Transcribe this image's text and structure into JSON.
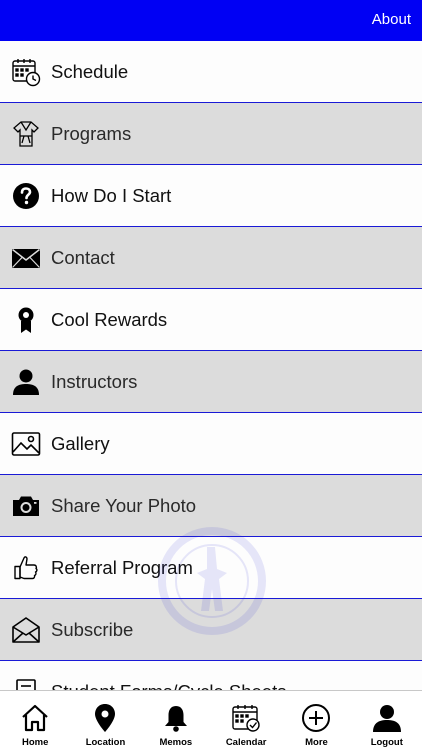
{
  "header": {
    "about_label": "About",
    "background_color": "#0000f4"
  },
  "menu": {
    "items": [
      {
        "label": "Schedule",
        "icon": "calendar-clock-icon"
      },
      {
        "label": "Programs",
        "icon": "martial-arts-uniform-icon"
      },
      {
        "label": "How Do I Start",
        "icon": "question-circle-icon"
      },
      {
        "label": "Contact",
        "icon": "envelope-icon"
      },
      {
        "label": "Cool Rewards",
        "icon": "award-ribbon-icon"
      },
      {
        "label": "Instructors",
        "icon": "person-icon"
      },
      {
        "label": "Gallery",
        "icon": "image-icon"
      },
      {
        "label": "Share Your Photo",
        "icon": "camera-icon"
      },
      {
        "label": "Referral Program",
        "icon": "thumbs-up-icon"
      },
      {
        "label": "Subscribe",
        "icon": "open-envelope-icon"
      },
      {
        "label": "Student Forms/Cycle Sheets",
        "icon": "document-icon"
      }
    ],
    "divider_color": "#1a1ad6",
    "row_colors": [
      "#fdfdfd",
      "#dcdcdc"
    ]
  },
  "tabbar": {
    "tabs": [
      {
        "label": "Home",
        "icon": "home-icon"
      },
      {
        "label": "Location",
        "icon": "location-pin-icon"
      },
      {
        "label": "Memos",
        "icon": "bell-icon"
      },
      {
        "label": "Calendar",
        "icon": "calendar-check-icon"
      },
      {
        "label": "More",
        "icon": "plus-circle-icon"
      },
      {
        "label": "Logout",
        "icon": "person-icon"
      }
    ]
  }
}
